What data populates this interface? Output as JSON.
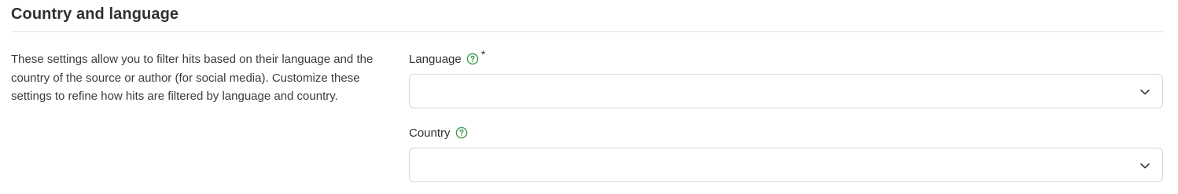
{
  "section": {
    "title": "Country and language",
    "description": "These settings allow you to filter hits based on their language and the country of the source or author (for social media). Customize these settings to refine how hits are filtered by language and country."
  },
  "fields": {
    "language": {
      "label": "Language",
      "required_mark": "*",
      "value": "",
      "help_icon": "question-circle-icon",
      "dropdown_icon": "chevron-down-icon"
    },
    "country": {
      "label": "Country",
      "value": "",
      "help_icon": "question-circle-icon",
      "dropdown_icon": "chevron-down-icon"
    }
  },
  "colors": {
    "help_icon": "#3f9a4f",
    "border": "#d5d7da",
    "divider": "#e2e3e5",
    "text": "#2f3033"
  }
}
